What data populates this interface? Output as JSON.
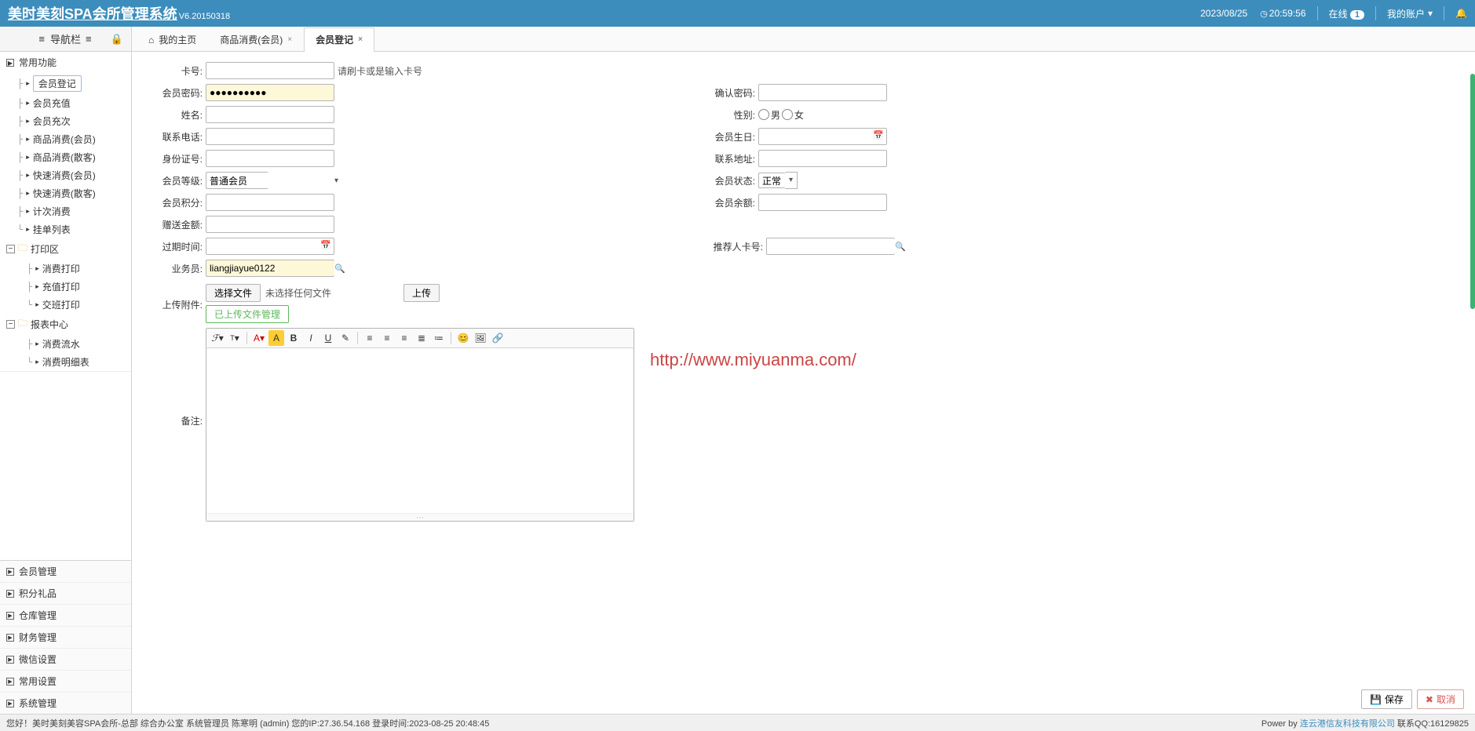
{
  "header": {
    "title": "美时美刻SPA会所管理系统",
    "version": "V6.20150318",
    "date": "2023/08/25",
    "time": "20:59:56",
    "online_label": "在线",
    "online_count": "1",
    "account_label": "我的账户"
  },
  "sidebar": {
    "nav_title": "导航栏",
    "groups": {
      "common": {
        "label": "常用功能",
        "items": [
          "会员登记",
          "会员充值",
          "会员充次",
          "商品消费(会员)",
          "商品消费(散客)",
          "快速消费(会员)",
          "快速消费(散客)",
          "计次消费",
          "挂单列表"
        ]
      },
      "print": {
        "label": "打印区",
        "items": [
          "消费打印",
          "充值打印",
          "交班打印"
        ]
      },
      "report": {
        "label": "报表中心",
        "items": [
          "消费流水",
          "消费明细表"
        ]
      }
    },
    "bottom": [
      "会员管理",
      "积分礼品",
      "仓库管理",
      "财务管理",
      "微信设置",
      "常用设置",
      "系统管理"
    ]
  },
  "tabs": [
    {
      "label": "我的主页",
      "home": true,
      "closable": false
    },
    {
      "label": "商品消费(会员)",
      "closable": true
    },
    {
      "label": "会员登记",
      "closable": true,
      "active": true
    }
  ],
  "form": {
    "card_no": {
      "label": "卡号:",
      "value": "",
      "hint": "请刷卡或是输入卡号"
    },
    "pwd": {
      "label": "会员密码:",
      "value": "●●●●●●●●●●"
    },
    "pwd2": {
      "label": "确认密码:",
      "value": ""
    },
    "name": {
      "label": "姓名:",
      "value": ""
    },
    "gender": {
      "label": "性别:",
      "male": "男",
      "female": "女"
    },
    "phone": {
      "label": "联系电话:",
      "value": ""
    },
    "birthday": {
      "label": "会员生日:",
      "value": ""
    },
    "idno": {
      "label": "身份证号:",
      "value": ""
    },
    "addr": {
      "label": "联系地址:",
      "value": ""
    },
    "level": {
      "label": "会员等级:",
      "value": "普通会员"
    },
    "status": {
      "label": "会员状态:",
      "value": "正常"
    },
    "points": {
      "label": "会员积分:",
      "value": ""
    },
    "balance": {
      "label": "会员余额:",
      "value": ""
    },
    "bonus": {
      "label": "赠送金额:",
      "value": ""
    },
    "expire": {
      "label": "过期时间:",
      "value": ""
    },
    "referrer": {
      "label": "推荐人卡号:",
      "value": ""
    },
    "sales": {
      "label": "业务员:",
      "value": "liangjiayue0122"
    },
    "upload": {
      "label": "上传附件:",
      "choose": "选择文件",
      "nofile": "未选择任何文件",
      "upload": "上传",
      "managed": "已上传文件管理"
    },
    "remark": {
      "label": "备注:"
    }
  },
  "actions": {
    "save": "保存",
    "cancel": "取消",
    "save_icon": "💾",
    "cancel_icon": "✖"
  },
  "watermark": "http://www.miyuanma.com/",
  "footer": {
    "left": "您好！美时美刻美容SPA会所-总部 综合办公室 系统管理员 陈寒明 (admin) 您的IP:27.36.54.168 登录时间:2023-08-25 20:48:45",
    "right_prefix": "Power by ",
    "right_link": "连云港信友科技有限公司",
    "right_suffix": " 联系QQ:16129825"
  }
}
